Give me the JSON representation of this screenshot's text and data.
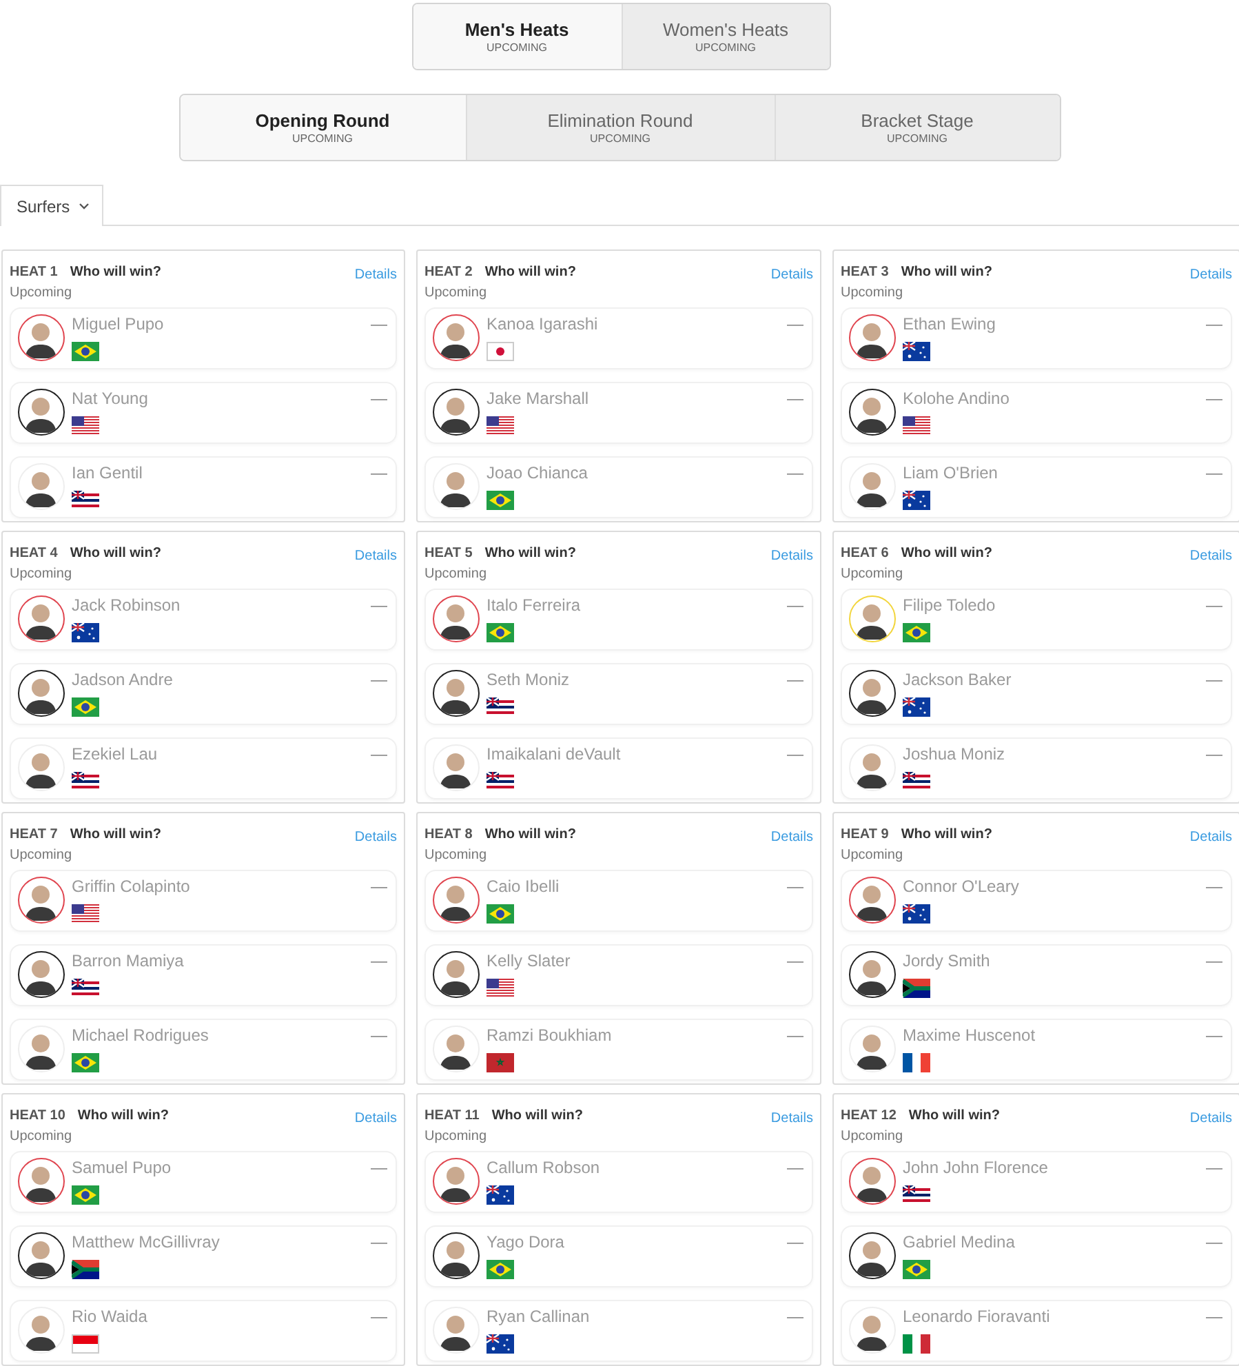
{
  "gender_tabs": [
    {
      "label": "Men's Heats",
      "status": "UPCOMING",
      "selected": true
    },
    {
      "label": "Women's Heats",
      "status": "UPCOMING",
      "selected": false
    }
  ],
  "round_tabs": [
    {
      "label": "Opening Round",
      "status": "UPCOMING",
      "selected": true
    },
    {
      "label": "Elimination Round",
      "status": "UPCOMING",
      "selected": false
    },
    {
      "label": "Bracket Stage",
      "status": "UPCOMING",
      "selected": false
    }
  ],
  "filter": {
    "label": "Surfers"
  },
  "heats": [
    {
      "heat": "HEAT 1",
      "question": "Who will win?",
      "link": "Details",
      "status": "Upcoming",
      "surfers": [
        {
          "name": "Miguel Pupo",
          "flag": {
            "kind": "br"
          },
          "color": "#e0454f",
          "score": "—"
        },
        {
          "name": "Nat Young",
          "flag": {
            "kind": "us"
          },
          "color": "#222222",
          "score": "—"
        },
        {
          "name": "Ian Gentil",
          "flag": {
            "kind": "hi"
          },
          "color": "#eeeeee",
          "score": "—"
        }
      ]
    },
    {
      "heat": "HEAT 2",
      "question": "Who will win?",
      "link": "Details",
      "status": "Upcoming",
      "surfers": [
        {
          "name": "Kanoa Igarashi",
          "flag": {
            "kind": "jp"
          },
          "color": "#e0454f",
          "score": "—"
        },
        {
          "name": "Jake Marshall",
          "flag": {
            "kind": "us"
          },
          "color": "#222222",
          "score": "—"
        },
        {
          "name": "Joao Chianca",
          "flag": {
            "kind": "br"
          },
          "color": "#eeeeee",
          "score": "—"
        }
      ]
    },
    {
      "heat": "HEAT 3",
      "question": "Who will win?",
      "link": "Details",
      "status": "Upcoming",
      "surfers": [
        {
          "name": "Ethan Ewing",
          "flag": {
            "kind": "au"
          },
          "color": "#e0454f",
          "score": "—"
        },
        {
          "name": "Kolohe Andino",
          "flag": {
            "kind": "us"
          },
          "color": "#222222",
          "score": "—"
        },
        {
          "name": "Liam O'Brien",
          "flag": {
            "kind": "au"
          },
          "color": "#eeeeee",
          "score": "—"
        }
      ]
    },
    {
      "heat": "HEAT 4",
      "question": "Who will win?",
      "link": "Details",
      "status": "Upcoming",
      "surfers": [
        {
          "name": "Jack Robinson",
          "flag": {
            "kind": "au"
          },
          "color": "#e0454f",
          "score": "—"
        },
        {
          "name": "Jadson Andre",
          "flag": {
            "kind": "br"
          },
          "color": "#222222",
          "score": "—"
        },
        {
          "name": "Ezekiel Lau",
          "flag": {
            "kind": "hi"
          },
          "color": "#eeeeee",
          "score": "—"
        }
      ]
    },
    {
      "heat": "HEAT 5",
      "question": "Who will win?",
      "link": "Details",
      "status": "Upcoming",
      "surfers": [
        {
          "name": "Italo Ferreira",
          "flag": {
            "kind": "br"
          },
          "color": "#e0454f",
          "score": "—"
        },
        {
          "name": "Seth Moniz",
          "flag": {
            "kind": "hi"
          },
          "color": "#222222",
          "score": "—"
        },
        {
          "name": "Imaikalani deVault",
          "flag": {
            "kind": "hi"
          },
          "color": "#eeeeee",
          "score": "—"
        }
      ]
    },
    {
      "heat": "HEAT 6",
      "question": "Who will win?",
      "link": "Details",
      "status": "Upcoming",
      "surfers": [
        {
          "name": "Filipe Toledo",
          "flag": {
            "kind": "br"
          },
          "color": "#f2d53c",
          "score": "—"
        },
        {
          "name": "Jackson Baker",
          "flag": {
            "kind": "au"
          },
          "color": "#222222",
          "score": "—"
        },
        {
          "name": "Joshua Moniz",
          "flag": {
            "kind": "hi"
          },
          "color": "#eeeeee",
          "score": "—"
        }
      ]
    },
    {
      "heat": "HEAT 7",
      "question": "Who will win?",
      "link": "Details",
      "status": "Upcoming",
      "surfers": [
        {
          "name": "Griffin Colapinto",
          "flag": {
            "kind": "us"
          },
          "color": "#e0454f",
          "score": "—"
        },
        {
          "name": "Barron Mamiya",
          "flag": {
            "kind": "hi"
          },
          "color": "#222222",
          "score": "—"
        },
        {
          "name": "Michael Rodrigues",
          "flag": {
            "kind": "br"
          },
          "color": "#eeeeee",
          "score": "—"
        }
      ]
    },
    {
      "heat": "HEAT 8",
      "question": "Who will win?",
      "link": "Details",
      "status": "Upcoming",
      "surfers": [
        {
          "name": "Caio Ibelli",
          "flag": {
            "kind": "br"
          },
          "color": "#e0454f",
          "score": "—"
        },
        {
          "name": "Kelly Slater",
          "flag": {
            "kind": "us"
          },
          "color": "#222222",
          "score": "—"
        },
        {
          "name": "Ramzi Boukhiam",
          "flag": {
            "kind": "ma"
          },
          "color": "#eeeeee",
          "score": "—"
        }
      ]
    },
    {
      "heat": "HEAT 9",
      "question": "Who will win?",
      "link": "Details",
      "status": "Upcoming",
      "surfers": [
        {
          "name": "Connor O'Leary",
          "flag": {
            "kind": "au"
          },
          "color": "#e0454f",
          "score": "—"
        },
        {
          "name": "Jordy Smith",
          "flag": {
            "kind": "za"
          },
          "color": "#222222",
          "score": "—"
        },
        {
          "name": "Maxime Huscenot",
          "flag": {
            "kind": "fr"
          },
          "color": "#eeeeee",
          "score": "—"
        }
      ]
    },
    {
      "heat": "HEAT 10",
      "question": "Who will win?",
      "link": "Details",
      "status": "Upcoming",
      "surfers": [
        {
          "name": "Samuel Pupo",
          "flag": {
            "kind": "br"
          },
          "color": "#e0454f",
          "score": "—"
        },
        {
          "name": "Matthew McGillivray",
          "flag": {
            "kind": "za"
          },
          "color": "#222222",
          "score": "—"
        },
        {
          "name": "Rio Waida",
          "flag": {
            "kind": "id"
          },
          "color": "#eeeeee",
          "score": "—"
        }
      ]
    },
    {
      "heat": "HEAT 11",
      "question": "Who will win?",
      "link": "Details",
      "status": "Upcoming",
      "surfers": [
        {
          "name": "Callum Robson",
          "flag": {
            "kind": "au"
          },
          "color": "#e0454f",
          "score": "—"
        },
        {
          "name": "Yago Dora",
          "flag": {
            "kind": "br"
          },
          "color": "#222222",
          "score": "—"
        },
        {
          "name": "Ryan Callinan",
          "flag": {
            "kind": "au"
          },
          "color": "#eeeeee",
          "score": "—"
        }
      ]
    },
    {
      "heat": "HEAT 12",
      "question": "Who will win?",
      "link": "Details",
      "status": "Upcoming",
      "surfers": [
        {
          "name": "John John Florence",
          "flag": {
            "kind": "hi"
          },
          "color": "#e0454f",
          "score": "—"
        },
        {
          "name": "Gabriel Medina",
          "flag": {
            "kind": "br"
          },
          "color": "#222222",
          "score": "—"
        },
        {
          "name": "Leonardo Fioravanti",
          "flag": {
            "kind": "it"
          },
          "color": "#eeeeee",
          "score": "—"
        }
      ]
    }
  ]
}
